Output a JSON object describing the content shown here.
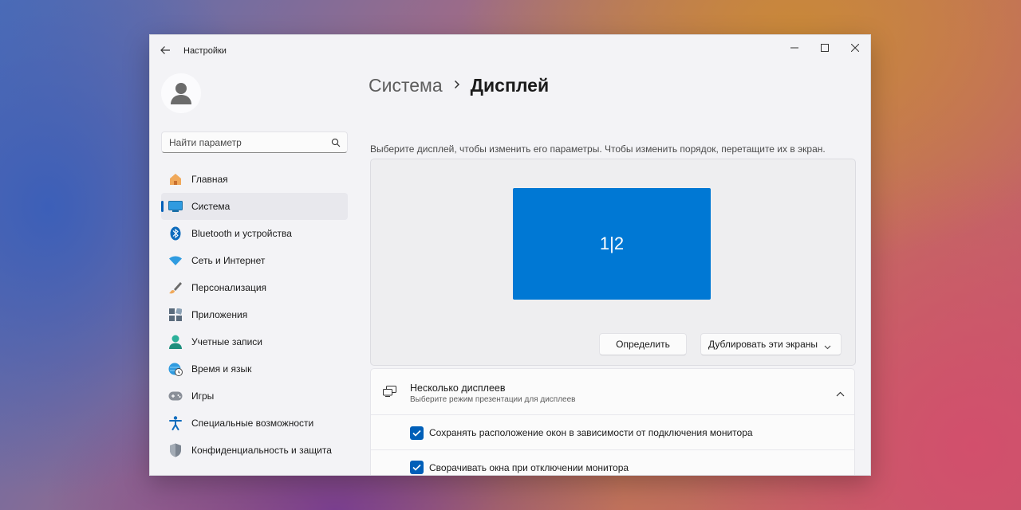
{
  "window": {
    "app_title": "Настройки"
  },
  "sidebar": {
    "search_placeholder": "Найти параметр",
    "items": [
      {
        "label": "Главная",
        "icon": "home-icon"
      },
      {
        "label": "Система",
        "icon": "monitor-icon",
        "active": true
      },
      {
        "label": "Bluetooth и устройства",
        "icon": "bluetooth-icon"
      },
      {
        "label": "Сеть и Интернет",
        "icon": "wifi-icon"
      },
      {
        "label": "Персонализация",
        "icon": "brush-icon"
      },
      {
        "label": "Приложения",
        "icon": "apps-icon"
      },
      {
        "label": "Учетные записи",
        "icon": "user-icon"
      },
      {
        "label": "Время и язык",
        "icon": "globe-clock-icon"
      },
      {
        "label": "Игры",
        "icon": "gamepad-icon"
      },
      {
        "label": "Специальные возможности",
        "icon": "accessibility-icon"
      },
      {
        "label": "Конфиденциальность и защита",
        "icon": "shield-icon"
      }
    ]
  },
  "main": {
    "breadcrumb": {
      "parent": "Система",
      "current": "Дисплей"
    },
    "hint": "Выберите дисплей, чтобы изменить его параметры. Чтобы изменить порядок, перетащите их в экран.",
    "monitor_label": "1|2",
    "identify_button": "Определить",
    "duplicate_select": "Дублировать эти экраны",
    "multi_display": {
      "title": "Несколько дисплеев",
      "subtitle": "Выберите режим презентации для дисплеев",
      "options": [
        {
          "label": "Сохранять расположение окон в зависимости от подключения монитора",
          "checked": true
        },
        {
          "label": "Сворачивать окна при отключении монитора",
          "checked": true
        }
      ]
    }
  },
  "colors": {
    "accent": "#0078d4",
    "accent_dark": "#005fb8",
    "window_bg": "#f3f3f6"
  }
}
